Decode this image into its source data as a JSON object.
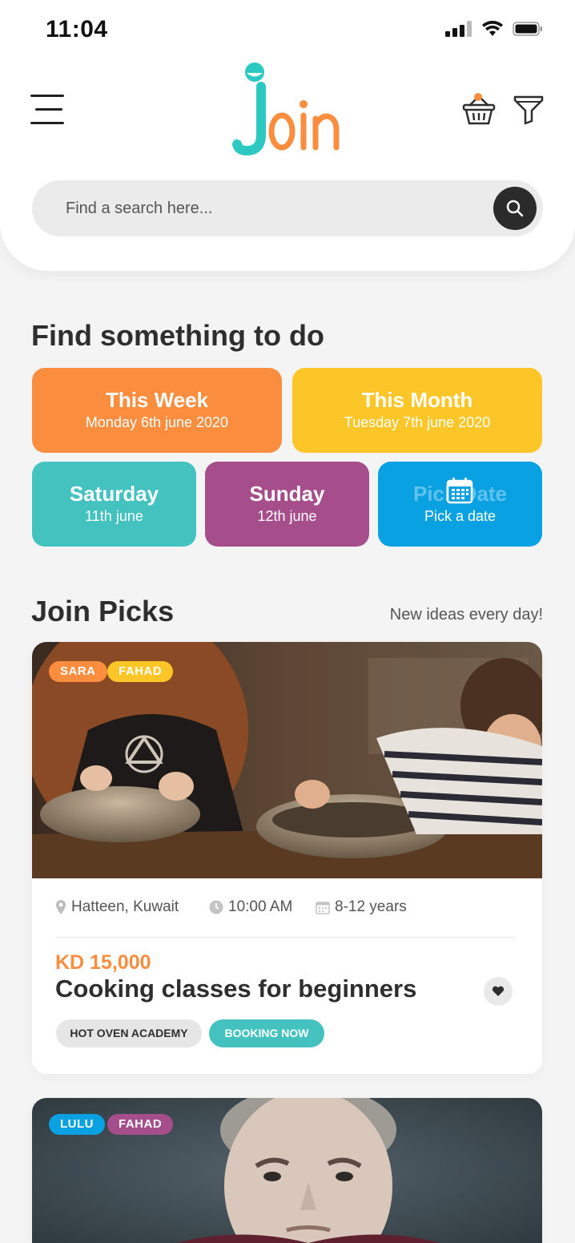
{
  "status_bar": {
    "time": "11:04"
  },
  "header": {
    "logo_text": "Join",
    "menu_icon": "hamburger-menu-icon",
    "basket_icon": "basket-icon",
    "filter_icon": "filter-funnel-icon"
  },
  "search": {
    "placeholder": "Find a search here...",
    "icon": "search-icon"
  },
  "find_section": {
    "title": "Find something to do",
    "tiles": [
      {
        "title": "This Week",
        "subtitle": "Monday 6th june 2020",
        "color": "#fb8d3e"
      },
      {
        "title": "This Month",
        "subtitle": "Tuesday 7th june 2020",
        "color": "#fdc628"
      },
      {
        "title": "Saturday",
        "subtitle": "11th june",
        "color": "#43c2c0"
      },
      {
        "title": "Sunday",
        "subtitle": "12th june",
        "color": "#a64e8c"
      },
      {
        "title": "Pick Date",
        "subtitle": "Pick a date",
        "color": "#0aa1e3",
        "icon": "calendar-icon"
      }
    ]
  },
  "picks": {
    "title": "Join Picks",
    "tagline": "New ideas every day!",
    "cards": [
      {
        "badges": [
          {
            "label": "SARA",
            "color": "#fb8d3e"
          },
          {
            "label": "FAHAD",
            "color": "#fdc628"
          }
        ],
        "location": "Hatteen, Kuwait",
        "time": "10:00 AM",
        "age": "8-12 years",
        "price": "KD 15,000",
        "title": "Cooking classes for beginners",
        "provider": "HOT OVEN ACADEMY",
        "cta": "BOOKING NOW"
      },
      {
        "badges": [
          {
            "label": "LULU",
            "color": "#0aa1e3"
          },
          {
            "label": "FAHAD",
            "color": "#a64e8c"
          }
        ]
      }
    ]
  }
}
